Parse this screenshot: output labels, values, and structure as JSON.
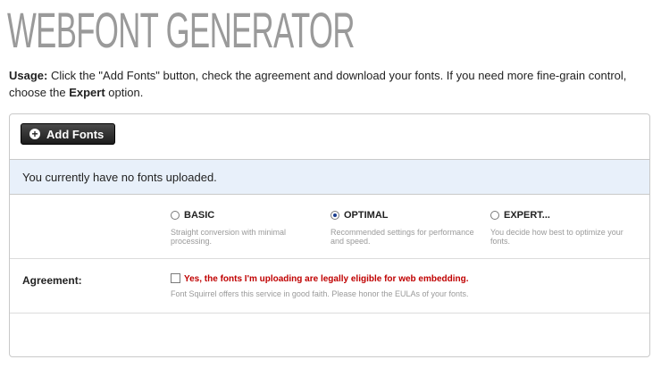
{
  "page": {
    "title": "WEBFONT GENERATOR",
    "usage_label": "Usage:",
    "usage_text_1": " Click the \"Add Fonts\" button, check the agreement and download your fonts. If you need more fine-grain control, choose the ",
    "usage_bold": "Expert",
    "usage_text_2": " option."
  },
  "toolbar": {
    "add_fonts_label": "Add Fonts",
    "add_icon": "plus-circle-icon"
  },
  "notice": {
    "text": "You currently have no fonts uploaded."
  },
  "modes": [
    {
      "label": "BASIC",
      "description": "Straight conversion with minimal processing.",
      "selected": false
    },
    {
      "label": "OPTIMAL",
      "description": "Recommended settings for performance and speed.",
      "selected": true
    },
    {
      "label": "EXPERT...",
      "description": "You decide how best to optimize your fonts.",
      "selected": false
    }
  ],
  "agreement": {
    "label": "Agreement:",
    "checkbox_text": "Yes, the fonts I'm uploading are legally eligible for web embedding.",
    "note": "Font Squirrel offers this service in good faith. Please honor the EULAs of your fonts.",
    "checked": false
  },
  "colors": {
    "title": "#9a9a9a",
    "notice_bg": "#e8f0fa",
    "warning_red": "#c00000",
    "button_dark": "#1c1c1c"
  }
}
